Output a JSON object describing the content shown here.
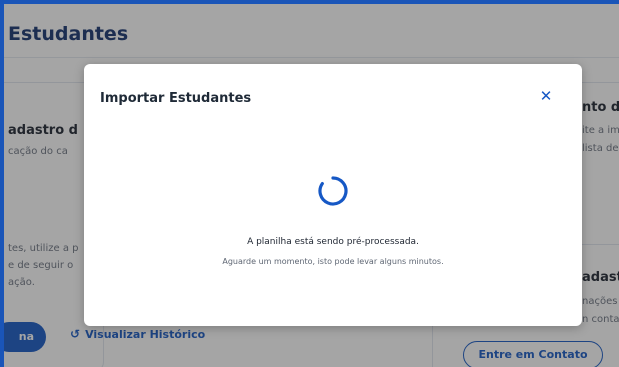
{
  "page": {
    "title": "Estudantes",
    "left_card": {
      "heading": "adastro d",
      "description": "cação do ca",
      "lines": [
        "tes, utilize a p",
        "e de seguir o",
        "ação."
      ]
    },
    "right_card": {
      "heading_1": "nto de",
      "lines_1": [
        "ite a im",
        "lista de"
      ],
      "heading_2": "adastra",
      "lines_2": [
        "nações",
        "n conta"
      ]
    },
    "primary_button_label": "na",
    "history_link_label": "Visualizar Histórico",
    "contact_button_label": "Entre em Contato"
  },
  "modal": {
    "title": "Importar Estudantes",
    "close_icon": "close-icon",
    "status_main": "A planilha está sendo pré-processada.",
    "status_sub": "Aguarde um momento, isto pode levar alguns minutos.",
    "spinner_color": "#1658c5"
  },
  "colors": {
    "brand_blue": "#1658c5",
    "frame_blue": "#1a55b8",
    "title_navy": "#15336e"
  }
}
